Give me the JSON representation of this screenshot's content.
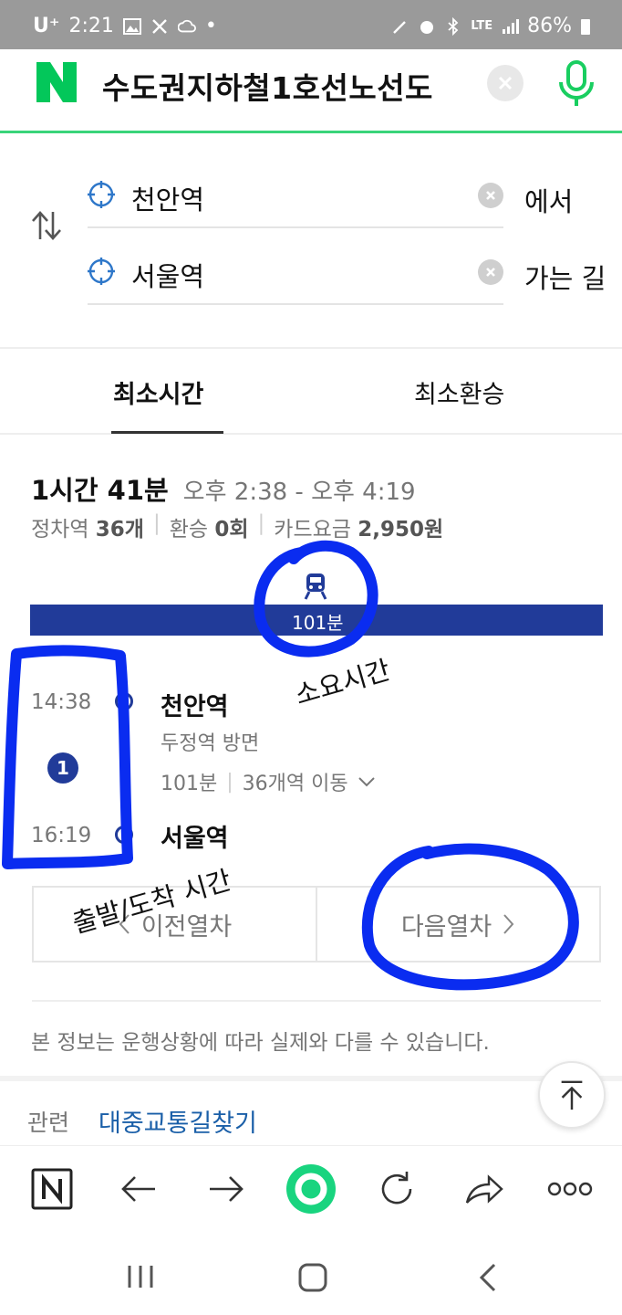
{
  "status_bar": {
    "carrier": "U⁺",
    "time": "2:21",
    "battery": "86%",
    "network": "LTE"
  },
  "header": {
    "logo_letter": "N",
    "query": "수도권지하철1호선노선도"
  },
  "route": {
    "origin": "천안역",
    "origin_suffix": "에서",
    "destination": "서울역",
    "destination_suffix": "가는 길"
  },
  "tabs": [
    {
      "label": "최소시간",
      "selected": true
    },
    {
      "label": "최소환승",
      "selected": false
    }
  ],
  "summary": {
    "total_time": "1시간 41분",
    "time_range": "오후 2:38 - 오후 4:19",
    "stops_label": "정차역",
    "stops_value": "36개",
    "transfers_label": "환승",
    "transfers_value": "0회",
    "fare_label": "카드요금",
    "fare_value": "2,950원"
  },
  "duration_bar": {
    "label": "101분",
    "fill_fraction": 1.0,
    "color": "#213b99"
  },
  "timeline": {
    "departure_time": "14:38",
    "arrival_time": "16:19",
    "line_number": "1",
    "line_color": "#213b99",
    "departure_station": "천안역",
    "direction": "두정역 방면",
    "ride_minutes": "101분",
    "stations_moved": "36개역 이동"
  },
  "buttons": {
    "prev_train": "이전열차",
    "next_train": "다음열차"
  },
  "notice": "본 정보는 운행상황에 따라 실제와 다를 수 있습니다.",
  "related": {
    "label": "관련",
    "link": "대중교통길찾기"
  },
  "annotations": {
    "duration_note": "소요시간",
    "time_note": "출발/도착 시간",
    "ink_color": "#0a2cf0"
  },
  "toolbar": {
    "icons": [
      "naver-home-icon",
      "back-arrow-icon",
      "forward-arrow-icon",
      "green-circle-icon",
      "refresh-icon",
      "share-icon",
      "more-icon"
    ]
  },
  "colors": {
    "accent_green": "#39d47a",
    "link_blue": "#1a5fa8",
    "line1_navy": "#213b99"
  }
}
